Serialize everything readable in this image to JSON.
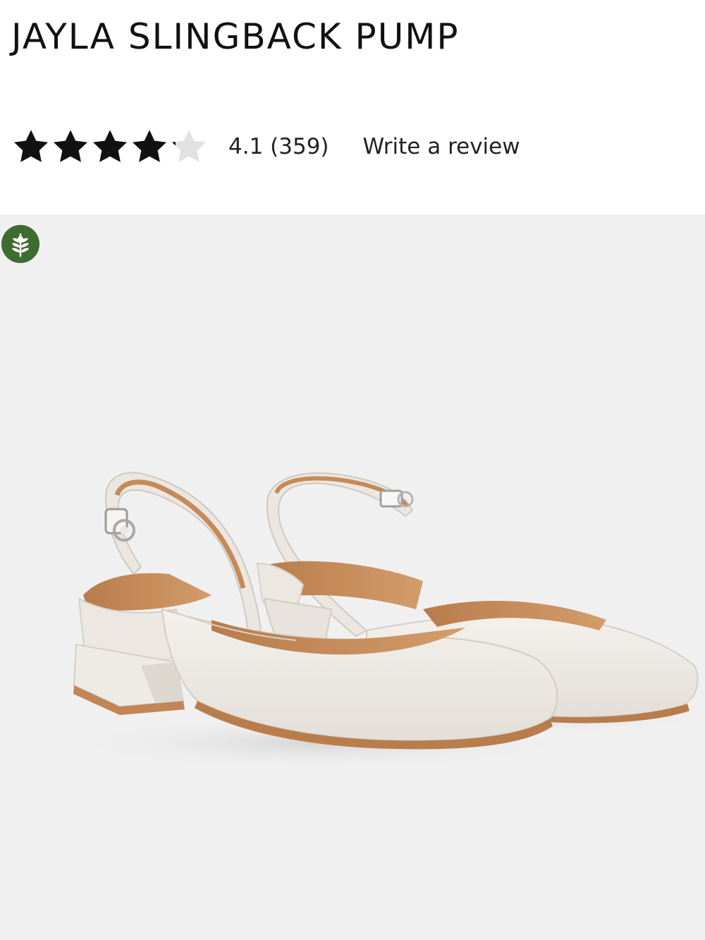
{
  "product": {
    "title": "JAYLA SLINGBACK PUMP",
    "rating": {
      "stars": 4.1,
      "text": "4.1 (359)",
      "write_review_label": "Write a review"
    }
  },
  "colors": {
    "text": "#111111",
    "star_filled": "#111111",
    "star_empty": "#e2e2e2",
    "image_background": "#f0f0f0",
    "badge": "#3e6b2f",
    "shoe_leather": "#ede9e2",
    "shoe_lining": "#c98f5d"
  },
  "icons": {
    "badge": "plant-leaf-icon",
    "star": "star-icon"
  }
}
